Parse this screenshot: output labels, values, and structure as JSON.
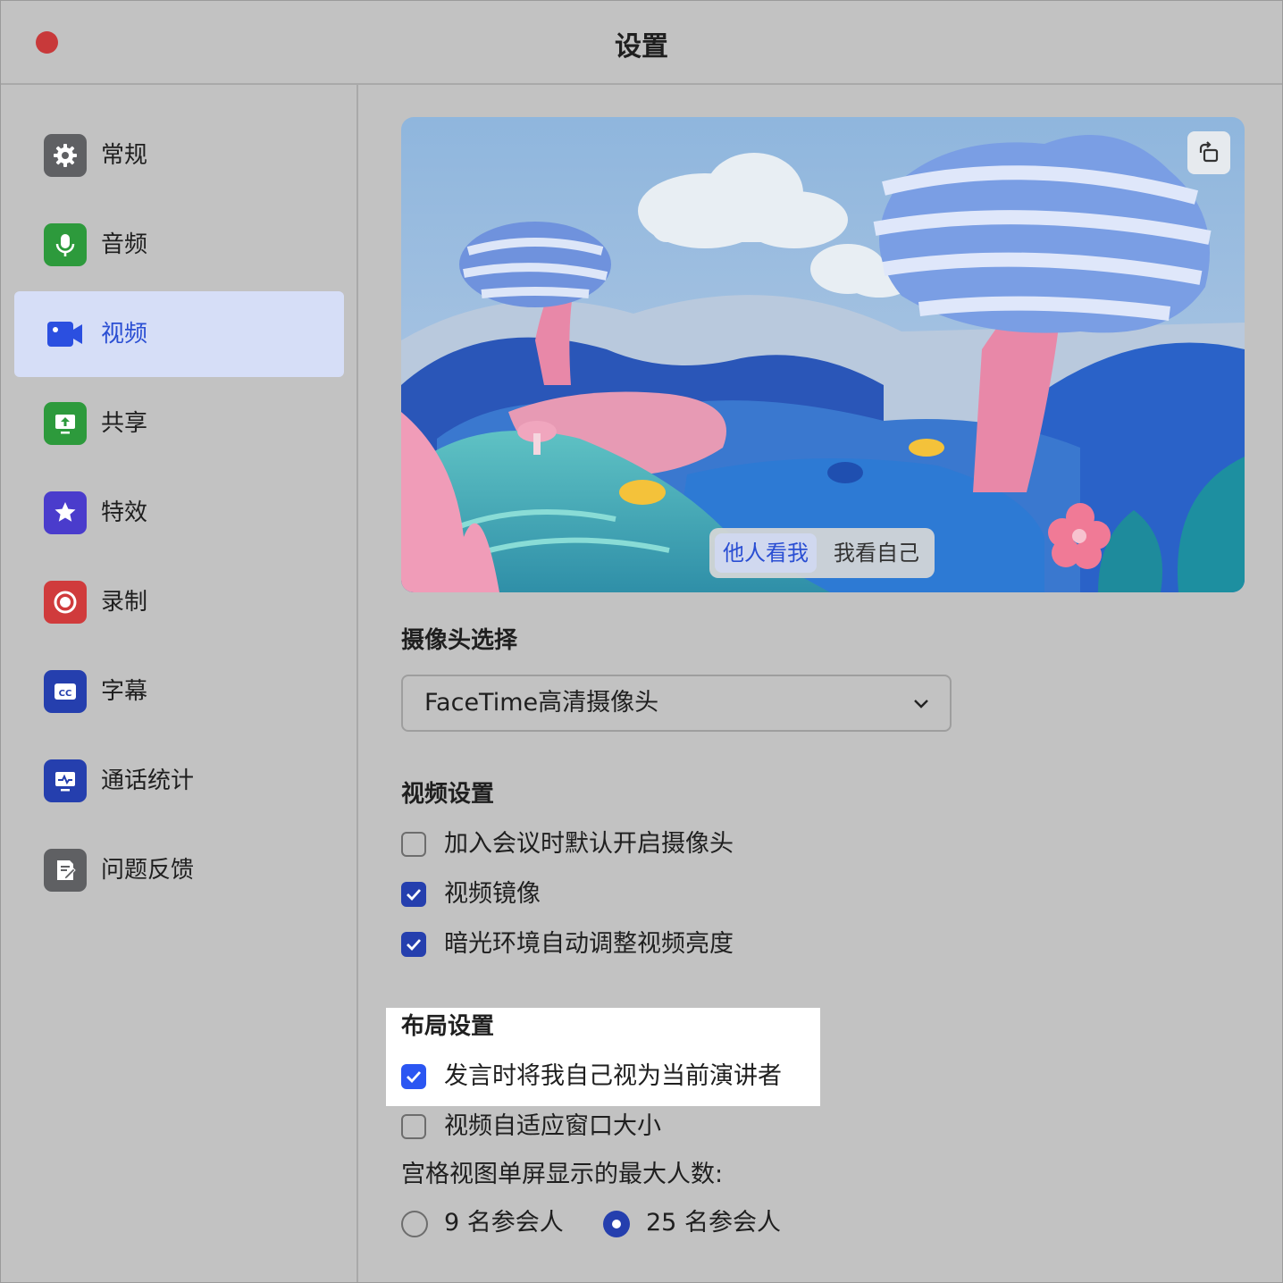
{
  "window": {
    "title": "设置"
  },
  "sidebar": {
    "items": [
      {
        "label": "常规",
        "icon": "gear-icon",
        "color": "#5f6063"
      },
      {
        "label": "音频",
        "icon": "microphone-icon",
        "color": "#2d9a3c"
      },
      {
        "label": "视频",
        "icon": "video-camera-icon",
        "color": "#2b4fe0"
      },
      {
        "label": "共享",
        "icon": "share-screen-icon",
        "color": "#2d9a3c"
      },
      {
        "label": "特效",
        "icon": "effects-star-icon",
        "color": "#4a3ccc"
      },
      {
        "label": "录制",
        "icon": "record-icon",
        "color": "#d03b3c"
      },
      {
        "label": "字幕",
        "icon": "captions-cc-icon",
        "color": "#253fae"
      },
      {
        "label": "通话统计",
        "icon": "statistics-monitor-icon",
        "color": "#253fae"
      },
      {
        "label": "问题反馈",
        "icon": "feedback-icon",
        "color": "#5f6063"
      }
    ],
    "active_index": 2
  },
  "preview": {
    "segment": {
      "options": [
        "他人看我",
        "我看自己"
      ],
      "selected": "他人看我"
    },
    "rotate_icon": "rotate-icon"
  },
  "camera": {
    "section_title": "摄像头选择",
    "selected": "FaceTime高清摄像头"
  },
  "video_settings": {
    "section_title": "视频设置",
    "options": [
      {
        "label": "加入会议时默认开启摄像头",
        "checked": false
      },
      {
        "label": "视频镜像",
        "checked": true
      },
      {
        "label": "暗光环境自动调整视频亮度",
        "checked": true
      }
    ]
  },
  "layout_settings": {
    "section_title": "布局设置",
    "options": [
      {
        "label": "发言时将我自己视为当前演讲者",
        "checked": true
      },
      {
        "label": "视频自适应窗口大小",
        "checked": false
      }
    ],
    "grid_label": "宫格视图单屏显示的最大人数:",
    "grid_options": [
      {
        "label": "9 名参会人",
        "selected": false
      },
      {
        "label": "25 名参会人",
        "selected": true
      }
    ]
  },
  "colors": {
    "accent": "#253fae",
    "highlight_accent": "#2b56f2",
    "active_nav_bg": "#d6def7"
  }
}
